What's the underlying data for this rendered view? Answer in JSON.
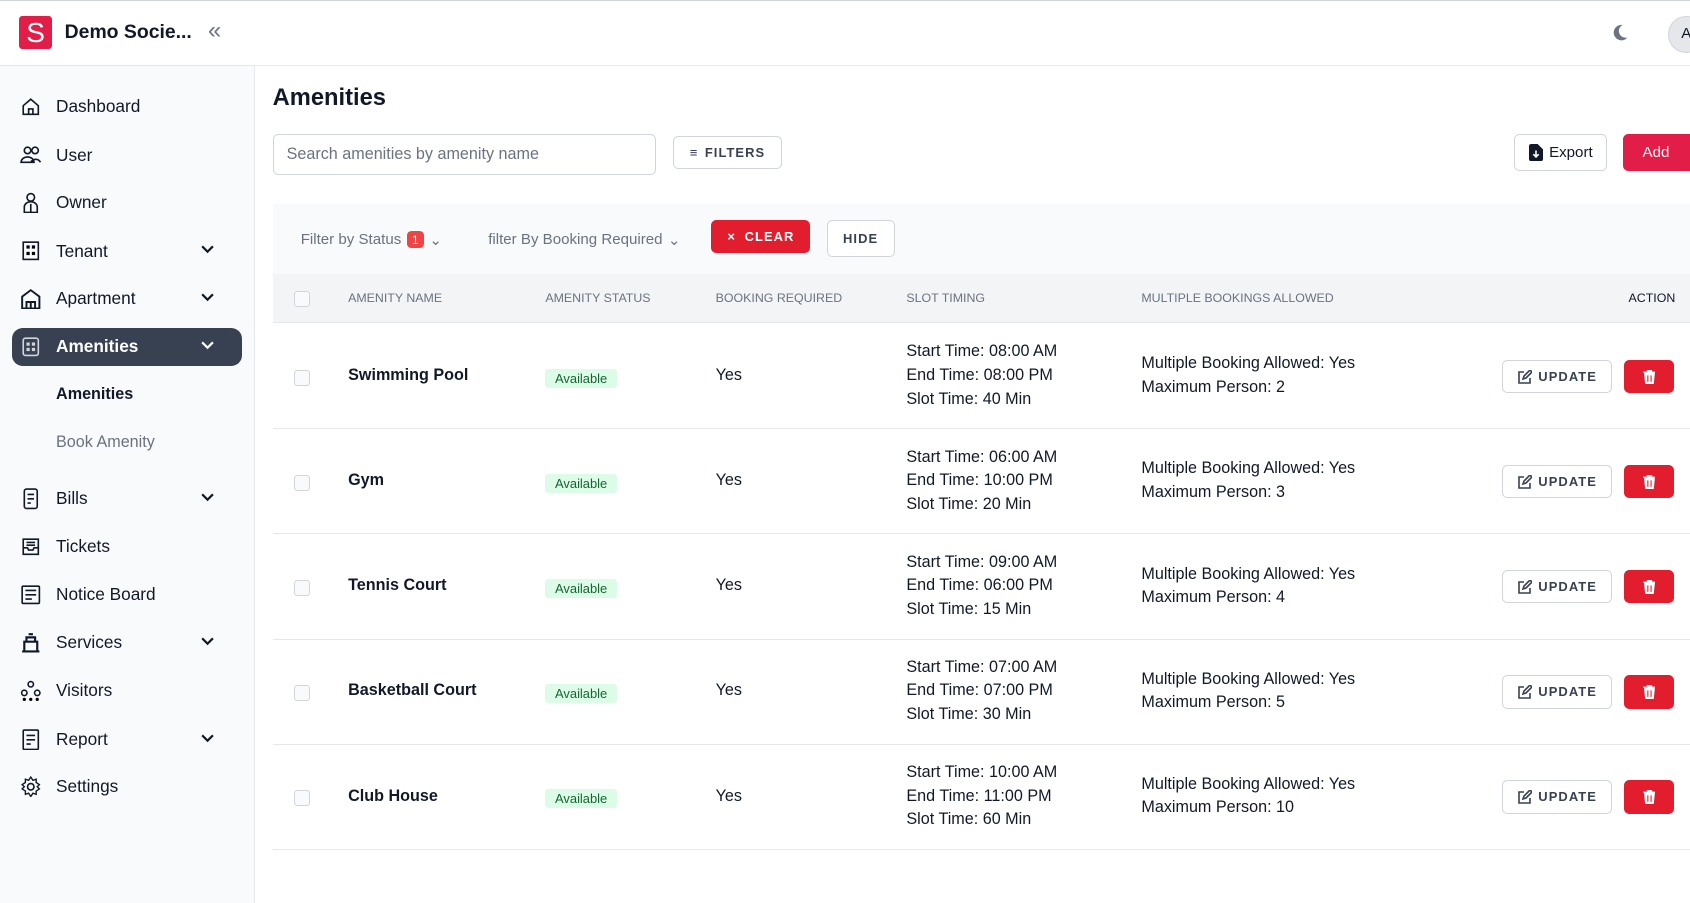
{
  "header": {
    "logo_letter": "S",
    "brand": "Demo Socie...",
    "avatar_initial": "A",
    "colors": {
      "brand": "#e11d48"
    }
  },
  "sidebar": {
    "items": [
      {
        "label": "Dashboard",
        "icon": "home-icon"
      },
      {
        "label": "User",
        "icon": "users-icon"
      },
      {
        "label": "Owner",
        "icon": "owner-icon"
      },
      {
        "label": "Tenant",
        "icon": "tenant-icon",
        "expandable": true
      },
      {
        "label": "Apartment",
        "icon": "apartment-icon",
        "expandable": true
      },
      {
        "label": "Amenities",
        "icon": "amenities-icon",
        "expandable": true,
        "active": true
      },
      {
        "label": "Bills",
        "icon": "bills-icon",
        "expandable": true
      },
      {
        "label": "Tickets",
        "icon": "tickets-icon"
      },
      {
        "label": "Notice Board",
        "icon": "notice-board-icon"
      },
      {
        "label": "Services",
        "icon": "services-icon",
        "expandable": true
      },
      {
        "label": "Visitors",
        "icon": "visitors-icon"
      },
      {
        "label": "Report",
        "icon": "report-icon",
        "expandable": true
      },
      {
        "label": "Settings",
        "icon": "gear-icon"
      }
    ],
    "subitems": [
      {
        "label": "Amenities",
        "active": true
      },
      {
        "label": "Book Amenity"
      }
    ]
  },
  "main": {
    "title": "Amenities",
    "search_placeholder": "Search amenities by amenity name",
    "filters_label": "FILTERS",
    "export_label": "Export",
    "add_label": "Add",
    "filterbar": {
      "status_label": "Filter by Status",
      "status_count": "1",
      "booking_label": "filter By Booking Required",
      "clear_label": "CLEAR",
      "hide_label": "HIDE"
    },
    "columns": [
      "AMENITY NAME",
      "AMENITY STATUS",
      "BOOKING REQUIRED",
      "SLOT TIMING",
      "MULTIPLE BOOKINGS ALLOWED",
      "ACTION"
    ],
    "update_label": "UPDATE",
    "rows": [
      {
        "name": "Swimming Pool",
        "status": "Available",
        "booking": "Yes",
        "start": "Start Time: 08:00 AM",
        "end": "End Time: 08:00 PM",
        "slot": "Slot Time: 40 Min",
        "multiple": "Multiple Booking Allowed: Yes",
        "max": "Maximum Person: 2"
      },
      {
        "name": "Gym",
        "status": "Available",
        "booking": "Yes",
        "start": "Start Time: 06:00 AM",
        "end": "End Time: 10:00 PM",
        "slot": "Slot Time: 20 Min",
        "multiple": "Multiple Booking Allowed: Yes",
        "max": "Maximum Person: 3"
      },
      {
        "name": "Tennis Court",
        "status": "Available",
        "booking": "Yes",
        "start": "Start Time: 09:00 AM",
        "end": "End Time: 06:00 PM",
        "slot": "Slot Time: 15 Min",
        "multiple": "Multiple Booking Allowed: Yes",
        "max": "Maximum Person: 4"
      },
      {
        "name": "Basketball Court",
        "status": "Available",
        "booking": "Yes",
        "start": "Start Time: 07:00 AM",
        "end": "End Time: 07:00 PM",
        "slot": "Slot Time: 30 Min",
        "multiple": "Multiple Booking Allowed: Yes",
        "max": "Maximum Person: 5"
      },
      {
        "name": "Club House",
        "status": "Available",
        "booking": "Yes",
        "start": "Start Time: 10:00 AM",
        "end": "End Time: 11:00 PM",
        "slot": "Slot Time: 60 Min",
        "multiple": "Multiple Booking Allowed: Yes",
        "max": "Maximum Person: 10"
      }
    ]
  }
}
